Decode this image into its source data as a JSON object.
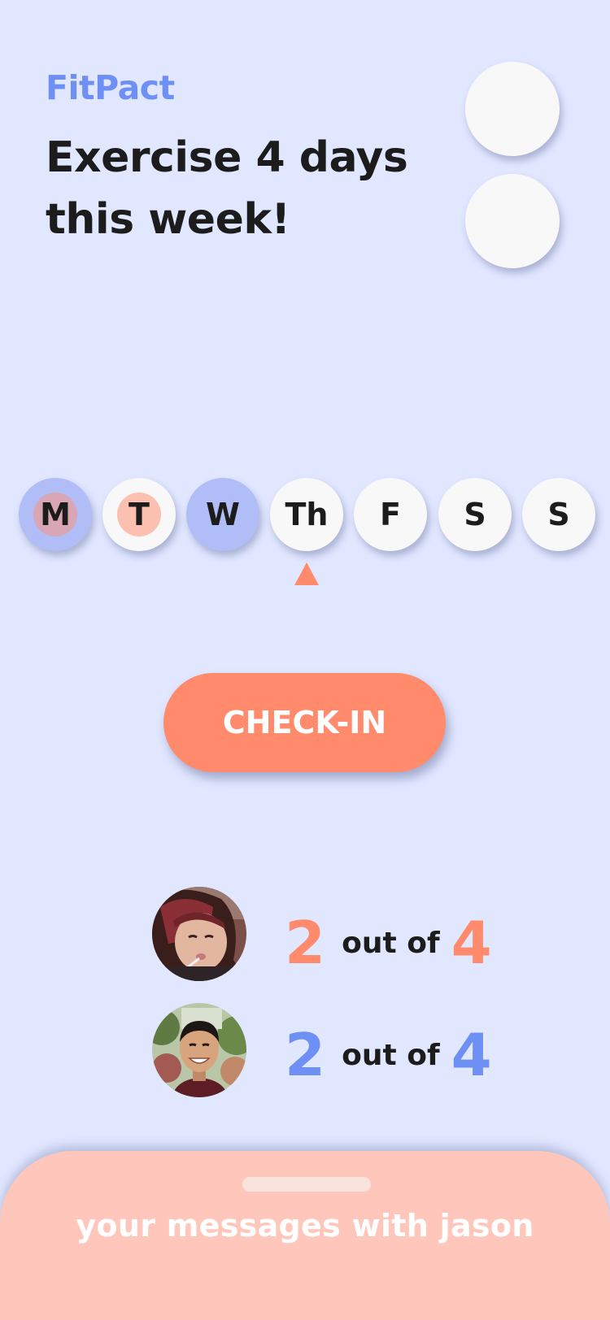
{
  "header": {
    "app_name": "FitPact",
    "goal_title": "Exercise 4 days this week!"
  },
  "week": {
    "days": [
      {
        "label": "M",
        "state": "done-both"
      },
      {
        "label": "T",
        "state": "done-partner"
      },
      {
        "label": "W",
        "state": "done-me"
      },
      {
        "label": "Th",
        "state": "today"
      },
      {
        "label": "F",
        "state": "upcoming"
      },
      {
        "label": "S",
        "state": "upcoming"
      },
      {
        "label": "S",
        "state": "upcoming"
      }
    ],
    "today_index": 3
  },
  "checkin": {
    "label": "CHECK-IN"
  },
  "progress": [
    {
      "done": "2",
      "out_of_label": "out of",
      "goal": "4",
      "color": "#ff8a6c"
    },
    {
      "done": "2",
      "out_of_label": "out of",
      "goal": "4",
      "color": "#6e8ff3"
    }
  ],
  "messages": {
    "label": "your messages with jason"
  },
  "colors": {
    "background": "#e1e7ff",
    "accent_orange": "#ff8a6c",
    "accent_blue": "#6e8ff3",
    "day_blue": "#b0bdf6",
    "sheet_peach": "#ffc7bb"
  }
}
